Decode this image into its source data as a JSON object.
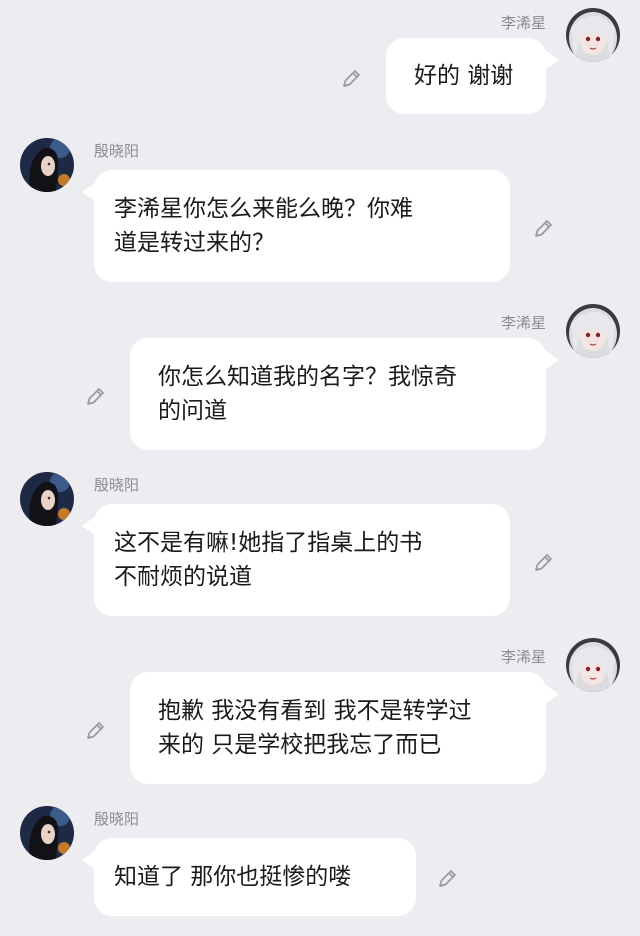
{
  "messages": [
    {
      "side": "right",
      "name": "李浠星",
      "text": "好的 谢谢"
    },
    {
      "side": "left",
      "name": "殷晓阳",
      "text": "李浠星你怎么来能么晚？你难\n道是转过来的？"
    },
    {
      "side": "right",
      "name": "李浠星",
      "text": "你怎么知道我的名字？我惊奇\n的问道"
    },
    {
      "side": "left",
      "name": "殷晓阳",
      "text": "这不是有嘛!她指了指桌上的书\n不耐烦的说道"
    },
    {
      "side": "right",
      "name": "李浠星",
      "text": "抱歉 我没有看到 我不是转学过\n来的 只是学校把我忘了而已"
    },
    {
      "side": "left",
      "name": "殷晓阳",
      "text": "知道了 那你也挺惨的喽"
    }
  ],
  "icons": {
    "edit": "pencil-edit-icon",
    "avatar_right": "white-hair-girl-avatar",
    "avatar_left": "dark-hair-girl-avatar"
  },
  "colors": {
    "background": "#ececf1",
    "bubble": "#ffffff",
    "name": "#8a8c93",
    "text": "#1a1a1a",
    "icon": "#9a9ca3"
  }
}
